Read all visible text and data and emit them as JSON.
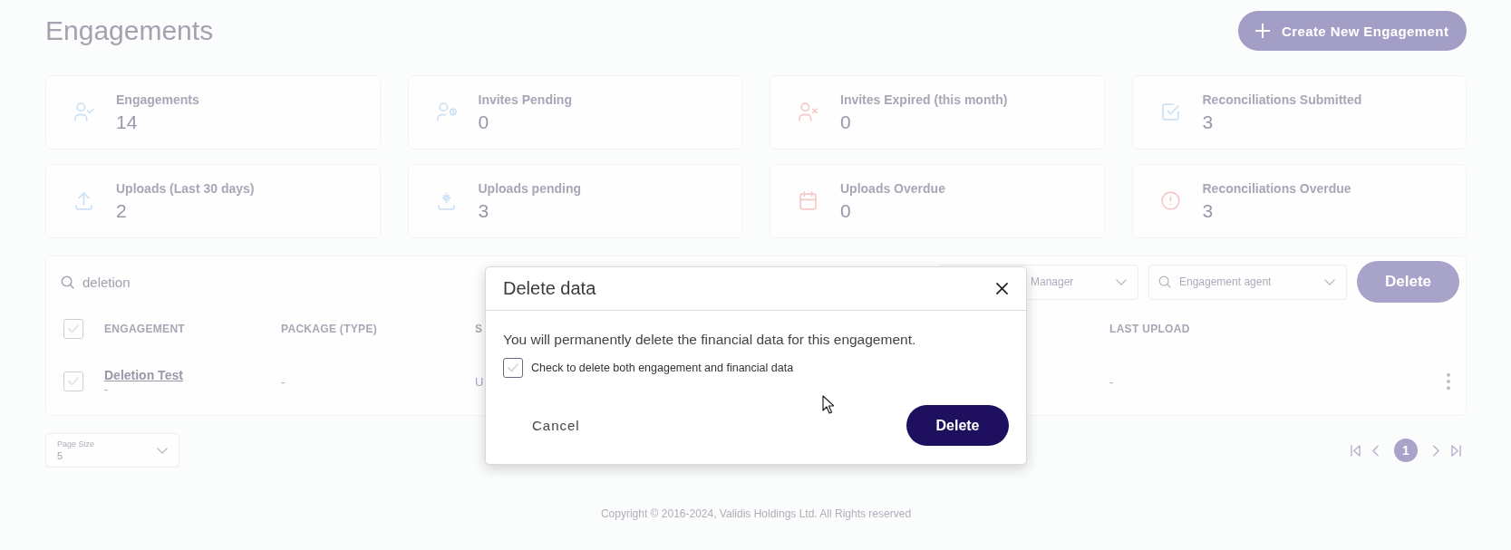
{
  "header": {
    "title": "Engagements",
    "create_button": "Create New Engagement"
  },
  "stats": [
    {
      "label": "Engagements",
      "value": "14",
      "color": "#cde1f4"
    },
    {
      "label": "Invites Pending",
      "value": "0",
      "color": "#cde1f4"
    },
    {
      "label": "Invites Expired (this month)",
      "value": "0",
      "color": "#f6c8c8"
    },
    {
      "label": "Reconciliations Submitted",
      "value": "3",
      "color": "#cde1f4"
    },
    {
      "label": "Uploads (Last 30 days)",
      "value": "2",
      "color": "#cde1f4"
    },
    {
      "label": "Uploads pending",
      "value": "3",
      "color": "#cde1f4"
    },
    {
      "label": "Uploads Overdue",
      "value": "0",
      "color": "#f6c8c8"
    },
    {
      "label": "Reconciliations Overdue",
      "value": "3",
      "color": "#f6c8c8"
    }
  ],
  "table": {
    "search": {
      "value": "deletion"
    },
    "filters": [
      {
        "kind": "select",
        "placeholder": "Manager"
      },
      {
        "kind": "search",
        "placeholder": "Engagement agent"
      }
    ],
    "delete_button": {
      "label": "Delete",
      "disabled": true
    },
    "header_checkbox": {
      "checked": false
    },
    "columns": [
      "ENGAGEMENT",
      "PACKAGE (TYPE)",
      "S",
      "LAST UPLOAD"
    ],
    "rows": [
      {
        "selected": false,
        "engagement": "Deletion Test",
        "engagement_detail": "-",
        "package": "-",
        "column_3": "U",
        "last_upload": "-"
      }
    ]
  },
  "page_size": {
    "label": "Page Size",
    "value": "5"
  },
  "pagination": {
    "pages": [
      {
        "label": "1",
        "selected": true
      }
    ]
  },
  "footer": "Copyright © 2016-2024, Validis Holdings Ltd. All Rights reserved",
  "dialog": {
    "title": "Delete data",
    "message": "You will permanently delete the financial data for this engagement.",
    "checkbox": {
      "label": "Check to delete both engagement and financial data",
      "checked": false
    },
    "cancel_button": "Cancel",
    "confirm_button": "Delete"
  }
}
